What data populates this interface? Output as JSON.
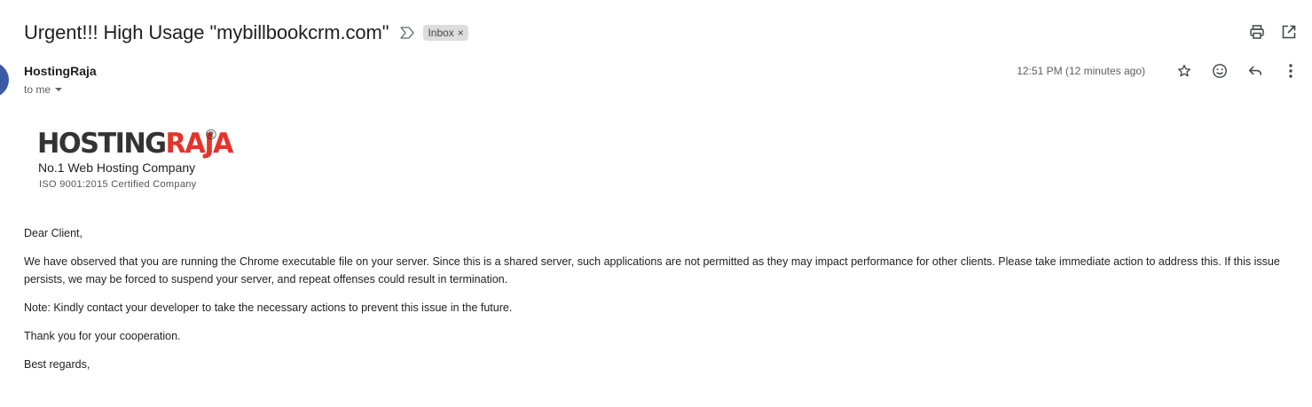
{
  "subject": "Urgent!!! High Usage \"mybillbookcrm.com\"",
  "label": {
    "name": "Inbox",
    "remove_symbol": "×"
  },
  "toolbar": {
    "print_icon": "print-icon",
    "open_new_window_icon": "open-in-new-icon"
  },
  "sender": {
    "name": "HostingRaja",
    "avatar_color": "#3b5ba5"
  },
  "recipient": {
    "text": "to me"
  },
  "timestamp": "12:51 PM (12 minutes ago)",
  "actions": {
    "star": "star-icon",
    "emoji": "emoji-icon",
    "reply": "reply-icon",
    "more": "more-vert-icon"
  },
  "logo": {
    "word_dark": "HOSTING",
    "word_red": "RAJA",
    "registered": "®",
    "tagline": "No.1 Web Hosting Company",
    "certification": "ISO 9001:2015 Certified Company",
    "colors": {
      "dark": "#333333",
      "red": "#e4342a"
    }
  },
  "message": {
    "greeting": "Dear Client,",
    "paragraph1": "We have observed that you are running the Chrome executable file on your server. Since this is a shared server, such applications are not permitted as they may impact performance for other clients. Please take immediate action to address this. If this issue persists, we may be forced to suspend your server, and repeat offenses could result in termination.",
    "note": "Note: Kindly contact your developer to take the necessary actions to prevent this issue in the future.",
    "thanks": "Thank you for your cooperation.",
    "signoff": "Best regards,"
  }
}
